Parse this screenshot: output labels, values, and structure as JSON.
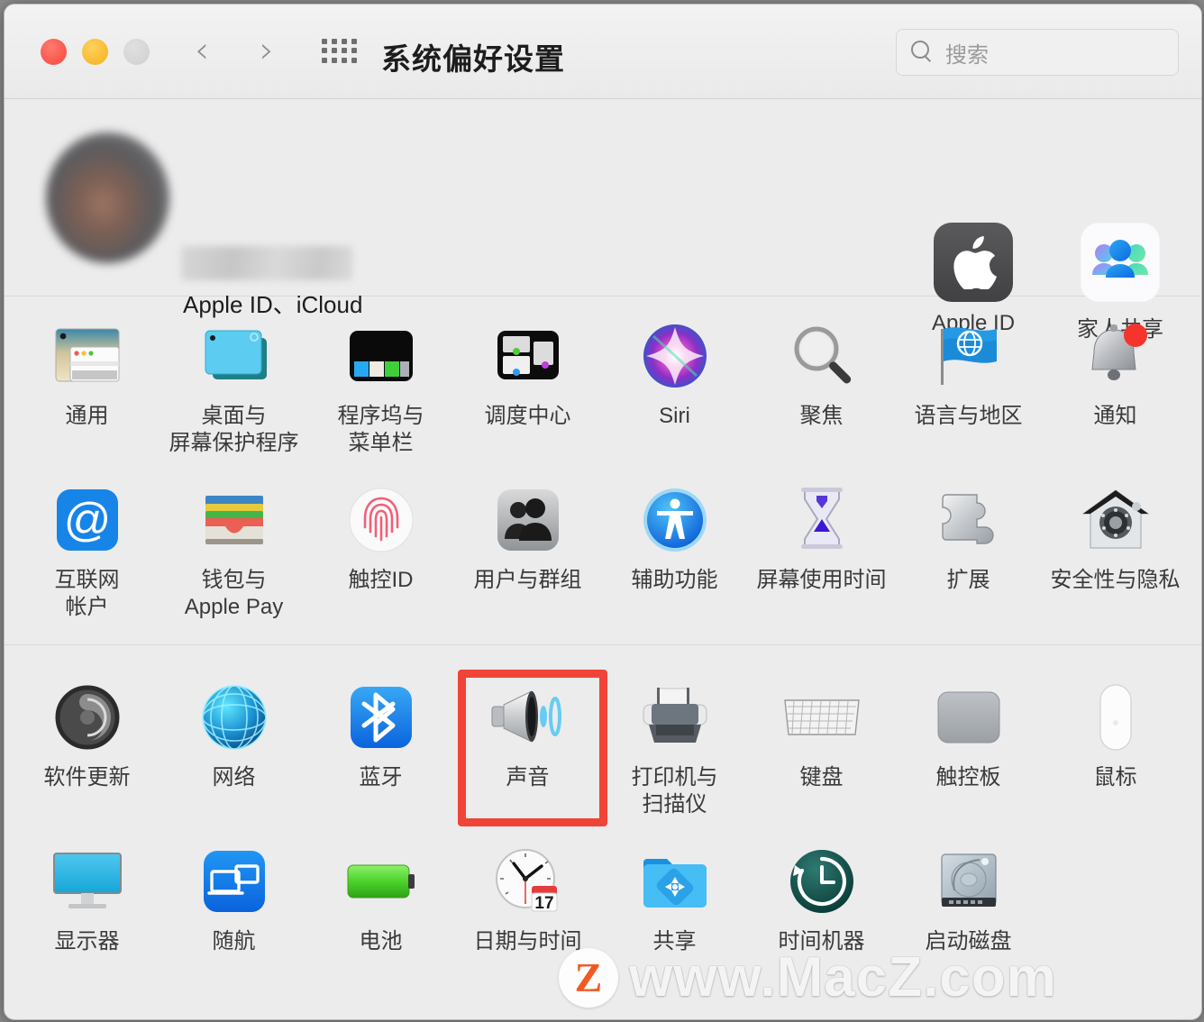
{
  "window": {
    "title": "系统偏好设置",
    "traffic_lights": [
      "close",
      "minimize",
      "zoom"
    ],
    "back_glyph": "‹",
    "forward_glyph": "›"
  },
  "search": {
    "placeholder": "搜索",
    "value": ""
  },
  "account": {
    "name_redacted": true,
    "subtitle": "Apple ID、iCloud",
    "shortcuts": [
      {
        "label": "Apple ID",
        "icon": "apple-logo-icon"
      },
      {
        "label": "家人共享",
        "icon": "family-sharing-icon"
      }
    ]
  },
  "groups": [
    {
      "id": "personal",
      "rows": [
        [
          {
            "label": "通用",
            "icon": "general-icon"
          },
          {
            "label": "桌面与\n屏幕保护程序",
            "icon": "desktop-screensaver-icon"
          },
          {
            "label": "程序坞与\n菜单栏",
            "icon": "dock-menubar-icon"
          },
          {
            "label": "调度中心",
            "icon": "mission-control-icon"
          },
          {
            "label": "Siri",
            "icon": "siri-icon"
          },
          {
            "label": "聚焦",
            "icon": "spotlight-icon"
          },
          {
            "label": "语言与地区",
            "icon": "language-region-icon"
          },
          {
            "label": "通知",
            "icon": "notifications-icon"
          }
        ],
        [
          {
            "label": "互联网\n帐户",
            "icon": "internet-accounts-icon"
          },
          {
            "label": "钱包与\nApple Pay",
            "icon": "wallet-applepay-icon"
          },
          {
            "label": "触控ID",
            "icon": "touch-id-icon"
          },
          {
            "label": "用户与群组",
            "icon": "users-groups-icon"
          },
          {
            "label": "辅助功能",
            "icon": "accessibility-icon"
          },
          {
            "label": "屏幕使用时间",
            "icon": "screen-time-icon"
          },
          {
            "label": "扩展",
            "icon": "extensions-icon"
          },
          {
            "label": "安全性与隐私",
            "icon": "security-privacy-icon"
          }
        ]
      ]
    },
    {
      "id": "hardware",
      "rows": [
        [
          {
            "label": "软件更新",
            "icon": "software-update-icon"
          },
          {
            "label": "网络",
            "icon": "network-icon"
          },
          {
            "label": "蓝牙",
            "icon": "bluetooth-icon"
          },
          {
            "label": "声音",
            "icon": "sound-icon",
            "highlighted": true
          },
          {
            "label": "打印机与\n扫描仪",
            "icon": "printers-scanners-icon"
          },
          {
            "label": "键盘",
            "icon": "keyboard-icon"
          },
          {
            "label": "触控板",
            "icon": "trackpad-icon"
          },
          {
            "label": "鼠标",
            "icon": "mouse-icon"
          }
        ],
        [
          {
            "label": "显示器",
            "icon": "displays-icon"
          },
          {
            "label": "随航",
            "icon": "sidecar-icon"
          },
          {
            "label": "电池",
            "icon": "battery-icon"
          },
          {
            "label": "日期与时间",
            "icon": "date-time-icon",
            "badge": "17"
          },
          {
            "label": "共享",
            "icon": "sharing-icon"
          },
          {
            "label": "时间机器",
            "icon": "time-machine-icon"
          },
          {
            "label": "启动磁盘",
            "icon": "startup-disk-icon"
          }
        ]
      ]
    }
  ],
  "highlight": {
    "target_label": "声音",
    "color": "#f04438"
  },
  "watermark": {
    "logo_letter": "Z",
    "text": "www.MacZ.com"
  }
}
